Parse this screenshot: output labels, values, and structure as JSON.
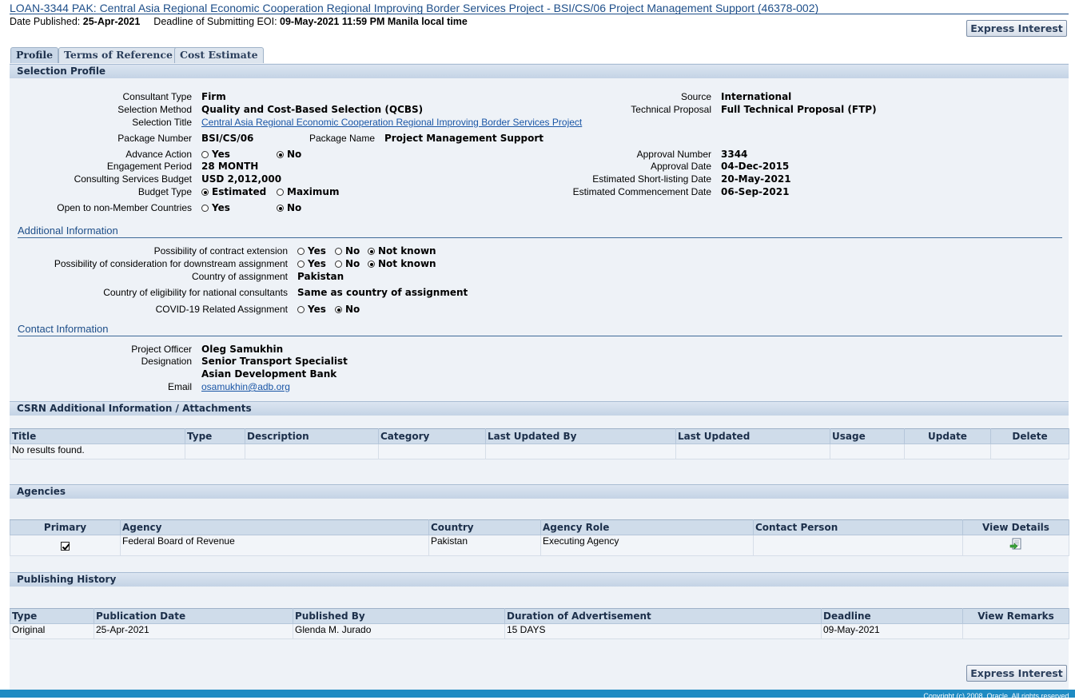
{
  "header": {
    "title": "LOAN-3344 PAK: Central Asia Regional Economic Cooperation Regional Improving Border Services Project - BSI/CS/06 Project Management Support (46378-002)",
    "date_published_label": "Date Published:",
    "date_published": "25-Apr-2021",
    "deadline_label": "Deadline of Submitting EOI:",
    "deadline": "09-May-2021 11:59 PM Manila local time",
    "express_interest": "Express Interest"
  },
  "tabs": [
    "Profile",
    "Terms of Reference",
    "Cost Estimate"
  ],
  "selection_profile": {
    "header": "Selection Profile",
    "consultant_type_label": "Consultant Type",
    "consultant_type": "Firm",
    "selection_method_label": "Selection Method",
    "selection_method": "Quality and Cost-Based Selection (QCBS)",
    "selection_title_label": "Selection Title",
    "selection_title": "Central Asia Regional Economic Cooperation Regional Improving Border Services Project",
    "package_number_label": "Package Number",
    "package_number": "BSI/CS/06",
    "package_name_label": "Package Name",
    "package_name": "Project Management Support",
    "advance_action_label": "Advance Action",
    "engagement_period_label": "Engagement Period",
    "engagement_period": "28 MONTH",
    "consulting_budget_label": "Consulting Services Budget",
    "consulting_budget": "USD 2,012,000",
    "budget_type_label": "Budget Type",
    "budget_type_estimated": "Estimated",
    "budget_type_maximum": "Maximum",
    "open_non_member_label": "Open to non-Member Countries",
    "yes": "Yes",
    "no": "No",
    "source_label": "Source",
    "source": "International",
    "technical_proposal_label": "Technical Proposal",
    "technical_proposal": "Full Technical Proposal (FTP)",
    "approval_number_label": "Approval Number",
    "approval_number": "3344",
    "approval_date_label": "Approval Date",
    "approval_date": "04-Dec-2015",
    "est_shortlisting_label": "Estimated Short-listing Date",
    "est_shortlisting": "20-May-2021",
    "est_commencement_label": "Estimated Commencement Date",
    "est_commencement": "06-Sep-2021"
  },
  "additional_info": {
    "header": "Additional Information",
    "contract_extension_label": "Possibility of contract extension",
    "downstream_label": "Possibility of consideration for downstream assignment",
    "country_assignment_label": "Country of assignment",
    "country_assignment": "Pakistan",
    "eligibility_label": "Country of eligibility for national consultants",
    "eligibility": "Same as country of assignment",
    "covid_label": "COVID-19 Related Assignment",
    "yes": "Yes",
    "no": "No",
    "not_known": "Not known"
  },
  "contact_info": {
    "header": "Contact Information",
    "officer_label": "Project Officer",
    "officer": "Oleg Samukhin",
    "designation_label": "Designation",
    "designation": "Senior Transport Specialist",
    "organization": "Asian Development Bank",
    "email_label": "Email",
    "email": "osamukhin@adb.org"
  },
  "csrn": {
    "header": "CSRN Additional Information / Attachments",
    "columns": [
      "Title",
      "Type",
      "Description",
      "Category",
      "Last Updated By",
      "Last Updated",
      "Usage",
      "Update",
      "Delete"
    ],
    "empty": "No results found."
  },
  "agencies": {
    "header": "Agencies",
    "columns": [
      "Primary",
      "Agency",
      "Country",
      "Agency Role",
      "Contact Person",
      "View Details"
    ],
    "rows": [
      {
        "agency": "Federal Board of Revenue",
        "country": "Pakistan",
        "role": "Executing Agency",
        "contact": ""
      }
    ]
  },
  "publishing_history": {
    "header": "Publishing History",
    "columns": [
      "Type",
      "Publication Date",
      "Published By",
      "Duration of Advertisement",
      "Deadline",
      "View Remarks"
    ],
    "rows": [
      {
        "type": "Original",
        "date": "25-Apr-2021",
        "by": "Glenda M. Jurado",
        "duration": "15 DAYS",
        "deadline": "09-May-2021",
        "remarks": ""
      }
    ]
  },
  "footer": {
    "express_interest": "Express Interest",
    "copyright": "Copyright (c) 2008, Oracle. All rights reserved."
  },
  "colors": {
    "accent": "#1d4e89",
    "footer_bar": "#1e8bc3",
    "panel": "#eef2f7"
  }
}
